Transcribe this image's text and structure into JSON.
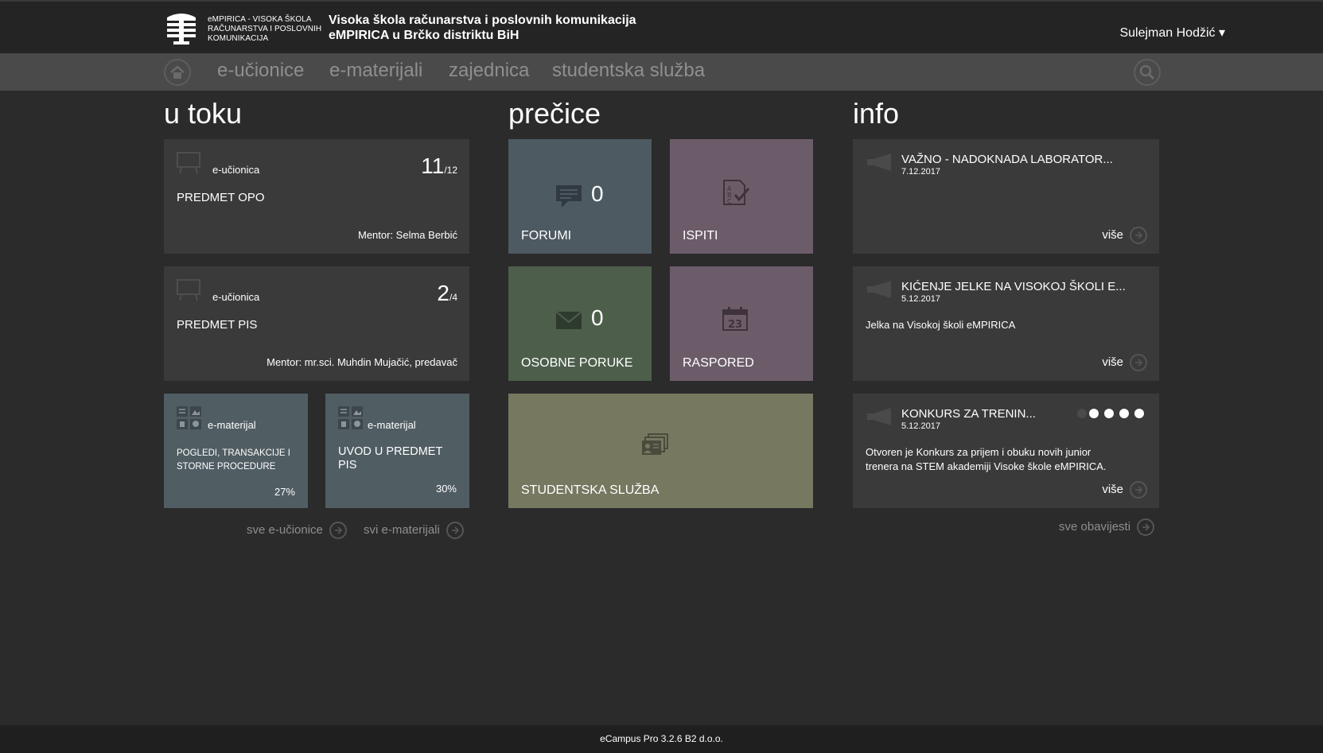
{
  "header": {
    "logo_text_line1": "eMPIRICA  -  VISOKA ŠKOLA",
    "logo_text_line2": "RAČUNARSTVA I POSLOVNIH",
    "logo_text_line3": "KOMUNIKACIJA",
    "title_line1": "Visoka škola računarstva i poslovnih komunikacija",
    "title_line2": "eMPIRICA u Brčko distriktu BiH",
    "user": "Sulejman Hodžić ▾"
  },
  "nav": {
    "items": [
      {
        "label": "e-učionice"
      },
      {
        "label": "e-materijali"
      },
      {
        "label": "zajednica"
      },
      {
        "label": "studentska služba"
      }
    ]
  },
  "columns": {
    "u_toku": "u toku",
    "precice": "prečice",
    "info": "info"
  },
  "in_progress": {
    "classrooms": [
      {
        "type": "e-učionica",
        "current": "11",
        "total": "/12",
        "name": "PREDMET OPO",
        "mentor": "Mentor: Selma Berbić"
      },
      {
        "type": "e-učionica",
        "current": "2",
        "total": "/4",
        "name": "PREDMET PIS",
        "mentor": "Mentor: mr.sci. Muhdin Mujačić, predavač"
      }
    ],
    "materials": [
      {
        "type": "e-materijal",
        "name_line1": "POGLEDI, TRANSAKCIJE I",
        "name_line2": "STORNE PROCEDURE",
        "progress": "27%",
        "progress_value": 27
      },
      {
        "type": "e-materijal",
        "name_line1": "UVOD U PREDMET",
        "name_line2": "PIS",
        "progress": "30%",
        "progress_value": 30
      }
    ],
    "all_classrooms_link": "sve e-učionice",
    "all_materials_link": "svi e-materijali"
  },
  "shortcuts": {
    "forumi": {
      "label": "FORUMI",
      "count": "0"
    },
    "ispiti": {
      "label": "ISPITI"
    },
    "poruke": {
      "label": "OSOBNE PORUKE",
      "count": "0"
    },
    "raspored": {
      "label": "RASPORED",
      "calendar_day": "23"
    },
    "sluzba": {
      "label": "STUDENTSKA SLUŽBA"
    }
  },
  "info": {
    "items": [
      {
        "title": "VAŽNO - NADOKNADA LABORATOR...",
        "date": "7.12.2017",
        "body_line1": "",
        "body_line2": "",
        "more": "više"
      },
      {
        "title": "KIĆENJE JELKE NA VISOKOJ ŠKOLI E...",
        "date": "5.12.2017",
        "body_line1": "Jelka na Visokoj školi eMPIRICA",
        "body_line2": "",
        "more": "više"
      },
      {
        "title": "KONKURS ZA TRENIN...",
        "date": "5.12.2017",
        "body_line1": "Otvoren je Konkurs za prijem i obuku novih junior",
        "body_line2": "trenera na STEM akademiji Visoke škole eMPIRICA.",
        "more": "više"
      }
    ],
    "all_link": "sve obavijesti"
  },
  "footer": {
    "text": "eCampus Pro 3.2.6 B2 d.o.o."
  },
  "colors": {
    "background": "#2b2b2b",
    "header": "#242424",
    "nav": "#4a4a4a",
    "tile_dark": "#3a3a3a",
    "tile_slate": "#505d63",
    "tile_mauve": "#6c5c6a",
    "tile_green": "#4d5f4b",
    "tile_olive": "#767860"
  }
}
